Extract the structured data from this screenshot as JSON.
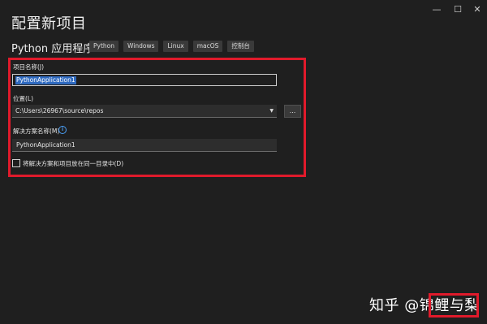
{
  "window": {
    "minimize_glyph": "—",
    "maximize_glyph": "☐",
    "close_glyph": "✕"
  },
  "header": {
    "title": "配置新项目",
    "template_name": "Python 应用程序",
    "tags": [
      "Python",
      "Windows",
      "Linux",
      "macOS",
      "控制台"
    ]
  },
  "form": {
    "project_name_label": "项目名称(J)",
    "project_name_value": "PythonApplication1",
    "location_label": "位置(L)",
    "location_value": "C:\\Users\\26967\\source\\repos",
    "browse_label": "...",
    "solution_name_label": "解决方案名称(M)",
    "solution_name_value": "PythonApplication1",
    "info_icon": "i",
    "same_dir_label": "将解决方案和项目放在同一目录中(D)",
    "same_dir_checked": false
  },
  "watermark": {
    "text": "知乎 @锦鲤与梨"
  },
  "colors": {
    "background": "#1f1f1f",
    "highlight_border": "#e01a2b",
    "selection": "#2f6ac0",
    "info_blue": "#4a9ef5"
  }
}
